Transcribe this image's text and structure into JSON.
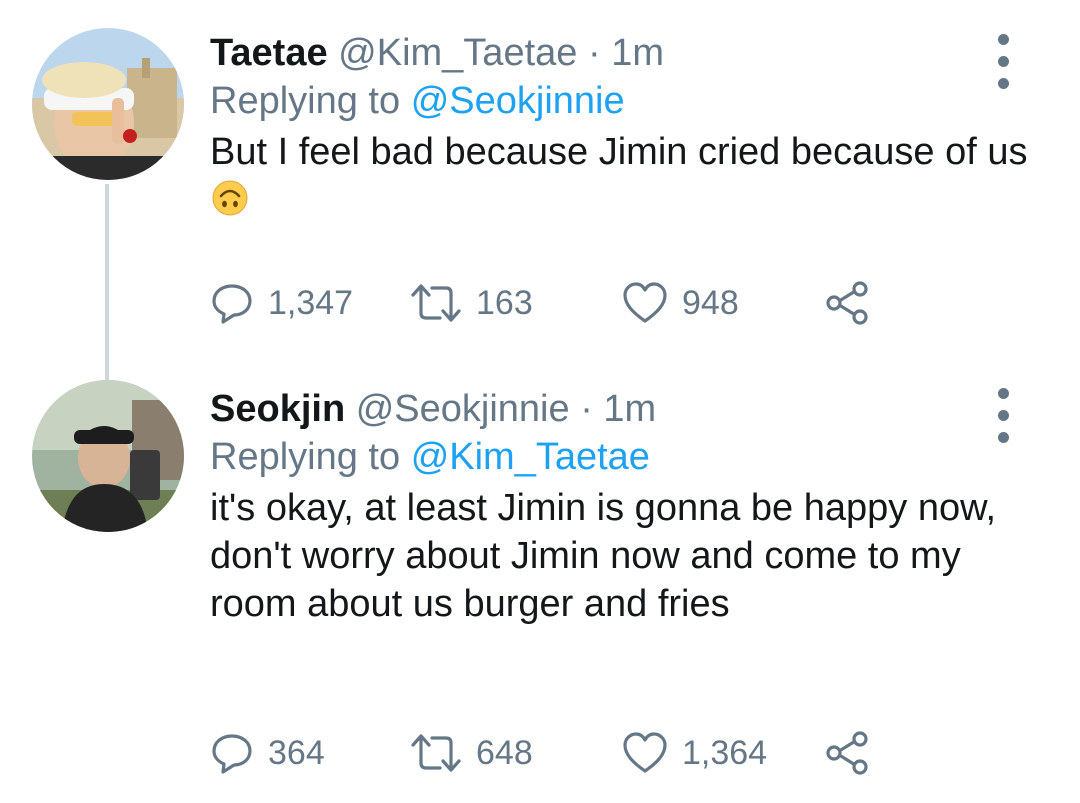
{
  "tweets": [
    {
      "display_name": "Taetae",
      "handle": "@Kim_Taetae",
      "time": "1m",
      "replying_prefix": "Replying to",
      "replying_to": "@Seokjinnie",
      "text": "But I feel bad because Jimin cried because of us",
      "emoji": "upside-down-face",
      "replies": "1,347",
      "retweets": "163",
      "likes": "948"
    },
    {
      "display_name": "Seokjin",
      "handle": "@Seokjinnie",
      "time": "1m",
      "replying_prefix": "Replying to",
      "replying_to": "@Kim_Taetae",
      "text": "it's okay, at least Jimin is gonna be happy now, don't worry about Jimin now and come to my room about us burger and fries",
      "replies": "364",
      "retweets": "648",
      "likes": "1,364"
    }
  ],
  "separator": "·",
  "icons": [
    "more-vertical-icon",
    "reply-icon",
    "retweet-icon",
    "like-icon",
    "share-icon"
  ],
  "colors": {
    "link": "#1da1f2",
    "secondary": "#657786",
    "text": "#14171a",
    "thread_line": "#ccd6dd"
  }
}
